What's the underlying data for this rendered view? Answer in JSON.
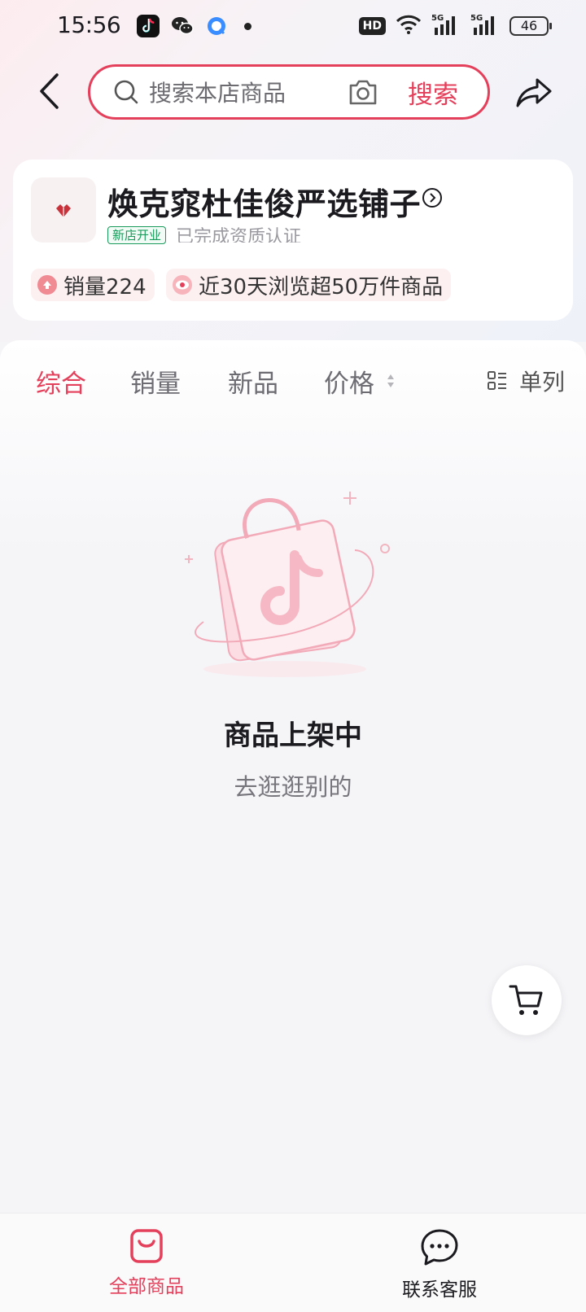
{
  "status_bar": {
    "time": "15:56",
    "network": "HD",
    "battery": "46",
    "icons": [
      "douyin-icon",
      "wechat-icon",
      "browser-icon",
      "notification-dot-icon",
      "wifi-icon",
      "signal-5g-icon",
      "signal-5g-icon"
    ]
  },
  "header": {
    "search_placeholder": "搜索本店商品",
    "search_button": "搜索"
  },
  "store": {
    "name": "焕克窕杜佳俊严选铺子",
    "badge": "新店开业",
    "certification": "已完成资质认证",
    "stats": [
      {
        "label": "销量224",
        "icon": "up-arrow-icon"
      },
      {
        "label": "近30天浏览超50万件商品",
        "icon": "eye-icon"
      }
    ]
  },
  "sort_tabs": [
    {
      "label": "综合",
      "active": true
    },
    {
      "label": "销量",
      "active": false
    },
    {
      "label": "新品",
      "active": false
    },
    {
      "label": "价格",
      "active": false
    }
  ],
  "layout_toggle": "单列",
  "empty_state": {
    "title": "商品上架中",
    "subtitle": "去逛逛别的"
  },
  "bottom_nav": [
    {
      "label": "全部商品",
      "active": true
    },
    {
      "label": "联系客服",
      "active": false
    }
  ],
  "colors": {
    "accent": "#e5405b",
    "badge_green": "#1a9b5b",
    "text_primary": "#1b1b1f",
    "text_secondary": "#76767c"
  }
}
